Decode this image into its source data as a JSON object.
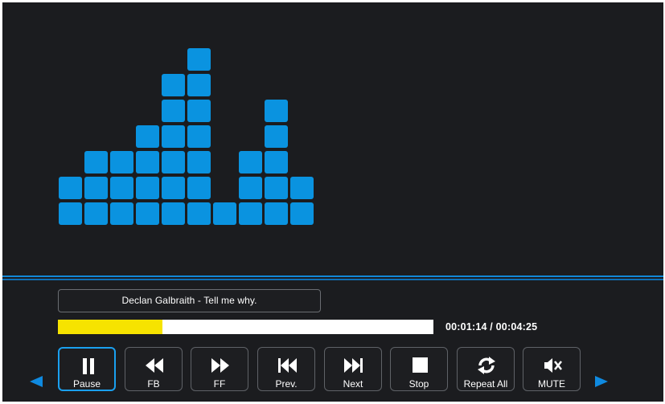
{
  "player": {
    "track_title": "Declan Galbraith - Tell me why.",
    "time_display": "00:01:14 / 00:04:25",
    "progress_fraction": 0.279,
    "accent_color": "#0a93e0",
    "progress_color": "#f6e300"
  },
  "visualizer": {
    "column_levels": [
      2,
      3,
      3,
      4,
      6,
      7,
      1,
      3,
      5,
      2
    ]
  },
  "navigation": {
    "prev_page_icon": "left-arrow-icon",
    "next_page_icon": "right-arrow-icon"
  },
  "controls": [
    {
      "key": "pause",
      "label": "Pause",
      "icon": "pause-icon",
      "selected": true
    },
    {
      "key": "fb",
      "label": "FB",
      "icon": "fast-backward-icon",
      "selected": false
    },
    {
      "key": "ff",
      "label": "FF",
      "icon": "fast-forward-icon",
      "selected": false
    },
    {
      "key": "prev",
      "label": "Prev.",
      "icon": "previous-track-icon",
      "selected": false
    },
    {
      "key": "next",
      "label": "Next",
      "icon": "next-track-icon",
      "selected": false
    },
    {
      "key": "stop",
      "label": "Stop",
      "icon": "stop-icon",
      "selected": false
    },
    {
      "key": "repeat",
      "label": "Repeat All",
      "icon": "repeat-icon",
      "selected": false
    },
    {
      "key": "mute",
      "label": "MUTE",
      "icon": "mute-icon",
      "selected": false
    }
  ]
}
